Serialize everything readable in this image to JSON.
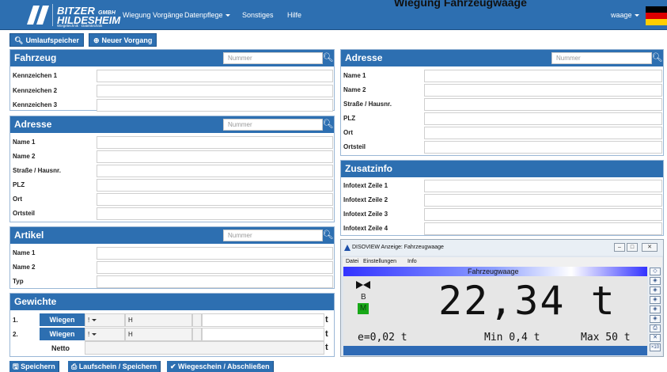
{
  "header": {
    "brand": {
      "line1": "BITZER",
      "line1_suffix": "GMBH",
      "line2": "HILDESHEIM",
      "line3": "Wiegetechnik · Datentechnik"
    },
    "nav": [
      "Wiegung",
      "Vorgänge",
      "Datenpflege",
      "Sonstiges",
      "Hilfe"
    ],
    "user": "waage",
    "page_title": "Wiegung Fahrzeugwaage"
  },
  "toolbar": {
    "umlaufspeicher": "Umlaufspeicher",
    "neuer_vorgang": "Neuer Vorgang"
  },
  "fahrzeug": {
    "title": "Fahrzeug",
    "search_placeholder": "Nummer",
    "fields": [
      "Kennzeichen 1",
      "Kennzeichen 2",
      "Kennzeichen 3"
    ]
  },
  "adresse_left": {
    "title": "Adresse",
    "search_placeholder": "Nummer",
    "fields": [
      "Name 1",
      "Name 2",
      "Straße / Hausnr.",
      "PLZ",
      "Ort",
      "Ortsteil"
    ]
  },
  "artikel": {
    "title": "Artikel",
    "search_placeholder": "Nummer",
    "fields": [
      "Name 1",
      "Name 2",
      "Typ"
    ]
  },
  "gewichte": {
    "title": "Gewichte",
    "rows": [
      {
        "index": "1.",
        "button": "Wiegen",
        "dropdown": "!",
        "h": "H",
        "unit": "t"
      },
      {
        "index": "2.",
        "button": "Wiegen",
        "dropdown": "!",
        "h": "H",
        "unit": "t"
      }
    ],
    "netto_label": "Netto",
    "netto_unit": "t"
  },
  "adresse_right": {
    "title": "Adresse",
    "search_placeholder": "Nummer",
    "fields": [
      "Name 1",
      "Name 2",
      "Straße / Hausnr.",
      "PLZ",
      "Ort",
      "Ortsteil"
    ]
  },
  "zusatzinfo": {
    "title": "Zusatzinfo",
    "fields": [
      "Infotext Zeile 1",
      "Infotext Zeile 2",
      "Infotext Zeile 3",
      "Infotext Zeile 4"
    ]
  },
  "disoview": {
    "window_title": "DISOVIEW Anzeige: Fahrzeugwaage",
    "menu": [
      "Datei",
      "Einstellungen",
      "Info"
    ],
    "scale_name": "Fahrzeugwaage",
    "status_b": "B",
    "status_m": "M",
    "weight": "22,34 t",
    "e_value": "e=0,02 t",
    "min_value": "Min 0,4 t",
    "max_value": "Max 50 t",
    "side_last": "×10"
  },
  "actions": {
    "speichern": "Speichern",
    "laufschein": "Laufschein / Speichern",
    "wiegeschein": "Wiegeschein / Abschließen"
  },
  "colors": {
    "primary": "#2d6fb1",
    "flag_black": "#000000",
    "flag_red": "#dd0000",
    "flag_gold": "#ffce00"
  }
}
